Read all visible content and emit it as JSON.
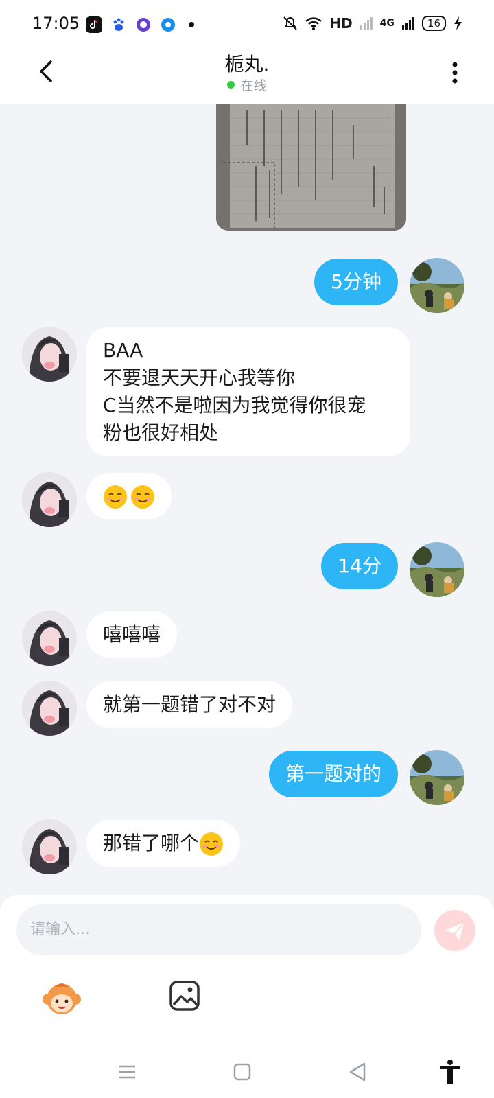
{
  "status_bar": {
    "time": "17:05",
    "network": "HD",
    "signal_type": "4G",
    "battery": "16"
  },
  "header": {
    "title": "栀丸.",
    "status": "在线"
  },
  "messages": [
    {
      "side": "out",
      "type": "image"
    },
    {
      "side": "out",
      "text": "5分钟"
    },
    {
      "side": "in",
      "lines": [
        "BAA",
        "不要退天天开心我等你",
        "C当然不是啦因为我觉得你很宠",
        "粉也很好相处"
      ]
    },
    {
      "side": "in",
      "emoji": [
        "smiling-face",
        "smiling-face"
      ]
    },
    {
      "side": "out",
      "text": "14分"
    },
    {
      "side": "in",
      "text": "嘻嘻嘻"
    },
    {
      "side": "in",
      "text": "就第一题错了对不对"
    },
    {
      "side": "out",
      "text": "第一题对的"
    },
    {
      "side": "in",
      "text": "那错了哪个",
      "emoji": [
        "smiling-face"
      ]
    }
  ],
  "composer": {
    "placeholder": "请输入..."
  },
  "colors": {
    "outgoing_bubble": "#2db5f5",
    "incoming_bubble": "#ffffff",
    "background": "#f3f4f8",
    "online_dot": "#2ecc40"
  }
}
